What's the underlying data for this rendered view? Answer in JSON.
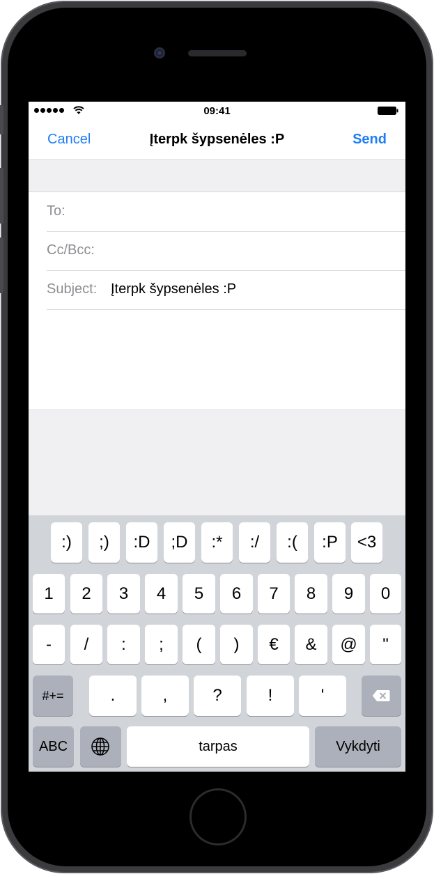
{
  "status": {
    "time": "09:41"
  },
  "nav": {
    "cancel": "Cancel",
    "title": "Įterpk šypsenėles :P",
    "send": "Send"
  },
  "fields": {
    "to_label": "To:",
    "cc_label": "Cc/Bcc:",
    "subject_label": "Subject:",
    "subject_value": "Įterpk šypsenėles :P"
  },
  "keyboard": {
    "emoji_row": [
      ":)",
      ";)",
      ":D",
      ";D",
      ":*",
      ":/",
      ":(",
      ":P",
      "<3"
    ],
    "number_row": [
      "1",
      "2",
      "3",
      "4",
      "5",
      "6",
      "7",
      "8",
      "9",
      "0"
    ],
    "symbol_row": [
      "-",
      "/",
      ":",
      ";",
      "(",
      ")",
      "€",
      "&",
      "@",
      "\""
    ],
    "punct_row": [
      ".",
      ",",
      "?",
      "!",
      "'"
    ],
    "more_symbols": "#+=",
    "abc": "ABC",
    "space": "tarpas",
    "return": "Vykdyti"
  },
  "colors": {
    "accent": "#1f7ef6",
    "keyboard_bg": "#d1d4d9",
    "dark_key": "#abb0ba"
  },
  "icons": {
    "backspace": "backspace-icon",
    "globe": "globe-icon",
    "wifi": "wifi-icon",
    "battery": "battery-icon"
  }
}
